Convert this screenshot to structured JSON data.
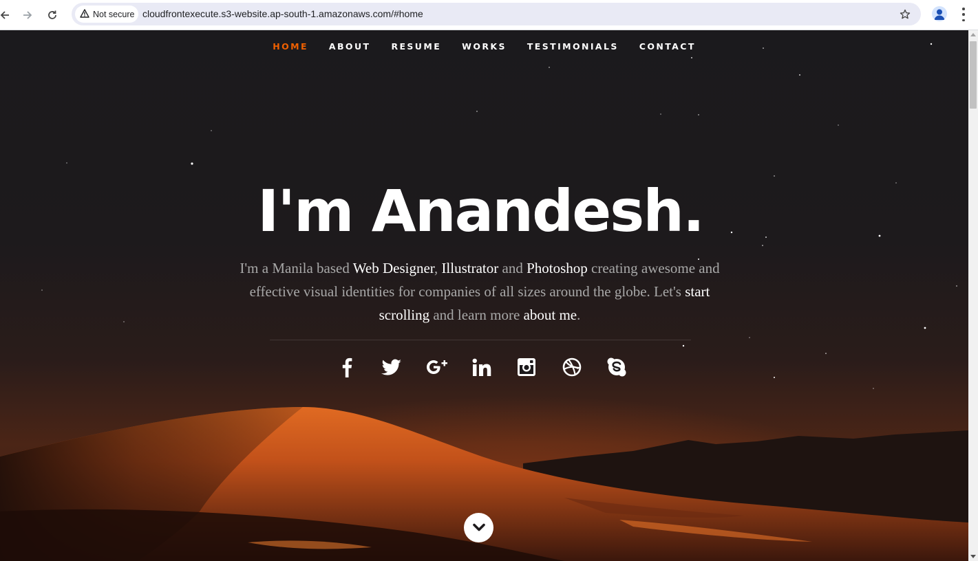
{
  "browser": {
    "security_label": "Not secure",
    "url": "cloudfrontexecute.s3-website.ap-south-1.amazonaws.com/#home"
  },
  "nav": {
    "items": [
      {
        "label": "HOME",
        "current": true
      },
      {
        "label": "ABOUT"
      },
      {
        "label": "RESUME"
      },
      {
        "label": "WORKS"
      },
      {
        "label": "TESTIMONIALS"
      },
      {
        "label": "CONTACT"
      }
    ]
  },
  "hero": {
    "headline": "I'm Anandesh.",
    "intro": {
      "p1": "I'm a Manila based ",
      "web_designer": "Web Designer",
      "p2": ", ",
      "illustrator": "Illustrator",
      "p3": " and ",
      "photoshop": "Photoshop",
      "p4": " creating awesome and effective visual identities for companies of all sizes around the globe. Let's ",
      "start_scrolling": "start scrolling",
      "p5": " and learn more ",
      "about_me": "about me",
      "p6": "."
    },
    "social_icons": [
      "facebook-icon",
      "twitter-icon",
      "google-plus-icon",
      "linkedin-icon",
      "instagram-icon",
      "dribbble-icon",
      "skype-icon"
    ]
  },
  "colors": {
    "accent": "#f06000",
    "background": "#1a181b",
    "dune": "#d8651e"
  }
}
